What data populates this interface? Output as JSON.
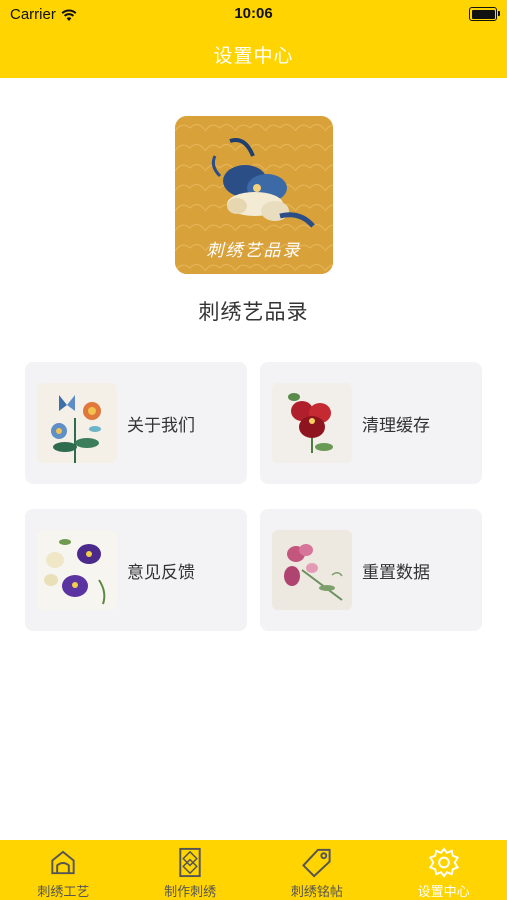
{
  "status_bar": {
    "carrier": "Carrier",
    "time": "10:06"
  },
  "nav": {
    "title": "设置中心"
  },
  "hero": {
    "logo_text": "刺绣艺品录",
    "app_name": "刺绣艺品录"
  },
  "cards": [
    {
      "label": "关于我们",
      "thumb": "butterfly-flowers-embroidery"
    },
    {
      "label": "清理缓存",
      "thumb": "red-pansy-embroidery"
    },
    {
      "label": "意见反馈",
      "thumb": "purple-pansy-embroidery"
    },
    {
      "label": "重置数据",
      "thumb": "pink-sweetpea-embroidery"
    }
  ],
  "tabs": [
    {
      "label": "刺绣工艺",
      "icon": "home-icon",
      "active": false
    },
    {
      "label": "制作刺绣",
      "icon": "pattern-frame-icon",
      "active": false
    },
    {
      "label": "刺绣铭帖",
      "icon": "tag-icon",
      "active": false
    },
    {
      "label": "设置中心",
      "icon": "gear-icon",
      "active": true
    }
  ],
  "colors": {
    "accent": "#FFD400",
    "card_bg": "#F3F3F5",
    "active_tab_text": "#FFFFFF"
  }
}
